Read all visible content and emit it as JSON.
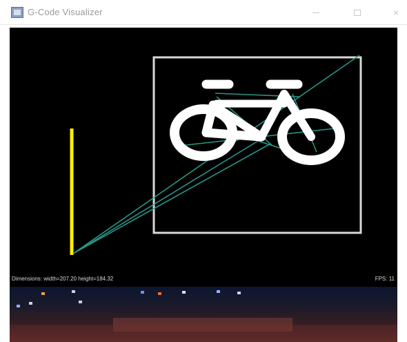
{
  "window": {
    "title": "G-Code Visualizer",
    "icon": "app-window-icon",
    "controls": {
      "minimize_icon": "minimize-icon",
      "maximize_icon": "maximize-icon",
      "close_glyph": "×"
    }
  },
  "canvas": {
    "background": "#000000",
    "frame_color": "#d9d9d9",
    "drawing_color": "#ffffff",
    "travel_color": "#2a9f8f",
    "axis_color": "#ffee00"
  },
  "status": {
    "dimensions": "Dimensions: width=207.20 height=184.32",
    "fps": "FPS: 11"
  },
  "console": {
    "theme": "dark-gradient"
  }
}
